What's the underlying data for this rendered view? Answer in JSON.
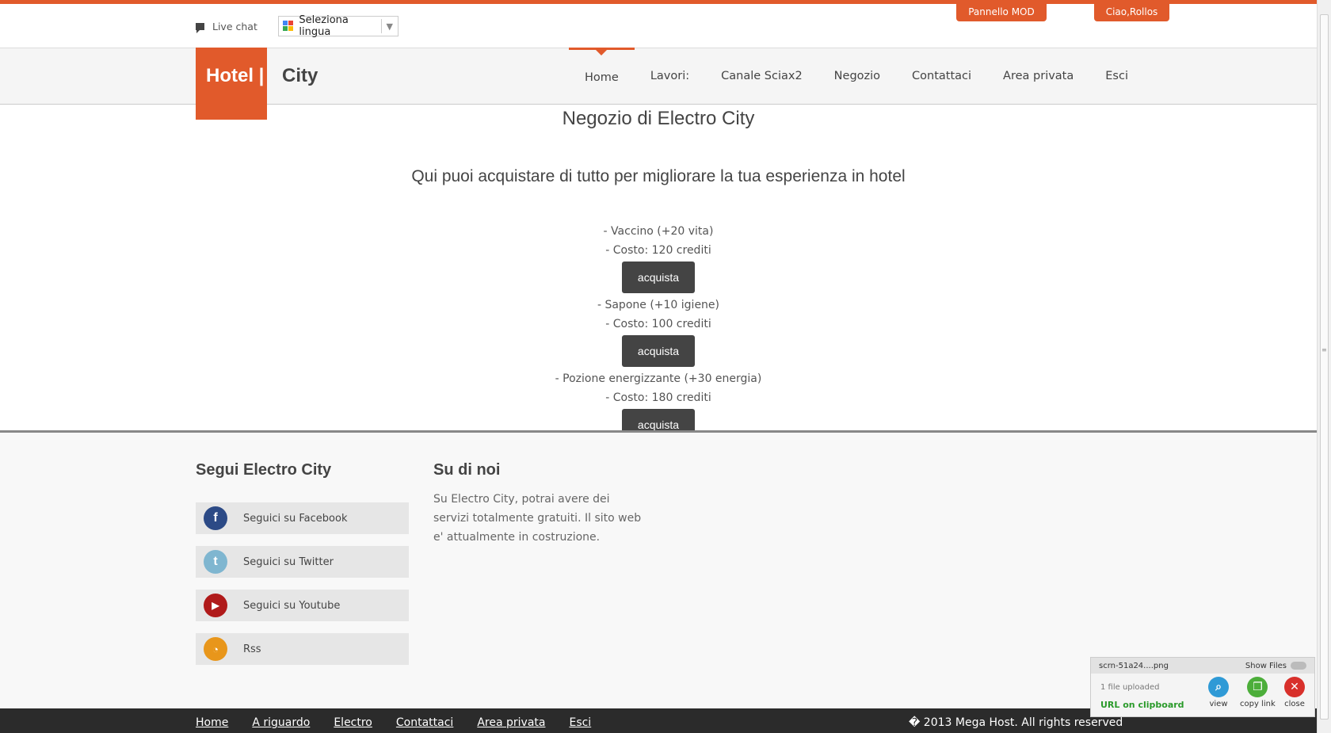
{
  "utility": {
    "live_chat": "Live chat",
    "language": "Seleziona lingua"
  },
  "top_buttons": {
    "mod_panel": "Pannello MOD",
    "user": "Ciao,Rollos"
  },
  "brand": {
    "hotel": "Hotel |",
    "city": "City"
  },
  "nav": {
    "items": [
      {
        "label": "Home"
      },
      {
        "label": "Lavori:"
      },
      {
        "label": "Canale Sciax2"
      },
      {
        "label": "Negozio"
      },
      {
        "label": "Contattaci"
      },
      {
        "label": "Area privata"
      },
      {
        "label": "Esci"
      }
    ],
    "active": "Home"
  },
  "main": {
    "title": "Negozio di Electro City",
    "subtitle": "Qui puoi acquistare di tutto per migliorare la tua esperienza in hotel",
    "products": [
      {
        "name": "- Vaccino (+20 vita)",
        "cost": "- Costo: 120 crediti",
        "button": "acquista"
      },
      {
        "name": "- Sapone (+10 igiene)",
        "cost": "- Costo: 100 crediti",
        "button": "acquista"
      },
      {
        "name": "- Pozione energizzante (+30 energia)",
        "cost": "- Costo: 180 crediti",
        "button": "acquista"
      }
    ]
  },
  "footer": {
    "follow_title": "Segui Electro City",
    "social": [
      {
        "label": "Seguici su Facebook",
        "icon": "facebook-icon",
        "color": "#2c4a86"
      },
      {
        "label": "Seguici su Twitter",
        "icon": "twitter-icon",
        "color": "#7fb6d0"
      },
      {
        "label": "Seguici su Youtube",
        "icon": "youtube-icon",
        "color": "#b01a1a"
      },
      {
        "label": "Rss",
        "icon": "rss-icon",
        "color": "#e8961b"
      }
    ],
    "about_title": "Su di noi",
    "about_text": "Su Electro City, potrai avere dei servizi totalmente gratuiti. Il sito web e' attualmente in costruzione.",
    "bottom_nav": [
      "Home",
      "A riguardo",
      "Electro",
      "Contattaci",
      "Area privata",
      "Esci"
    ],
    "copyright": "� 2013 Mega Host. All rights reserved"
  },
  "upload_widget": {
    "filename": "scrn-51a24....png",
    "show_files": "Show Files",
    "status": "1 file uploaded",
    "clipboard": "URL on clipboard",
    "actions": [
      "view",
      "copy link",
      "close"
    ]
  },
  "colors": {
    "accent": "#e15a2b",
    "button_dark": "#444444",
    "footer_bar": "#2b2b2b"
  }
}
